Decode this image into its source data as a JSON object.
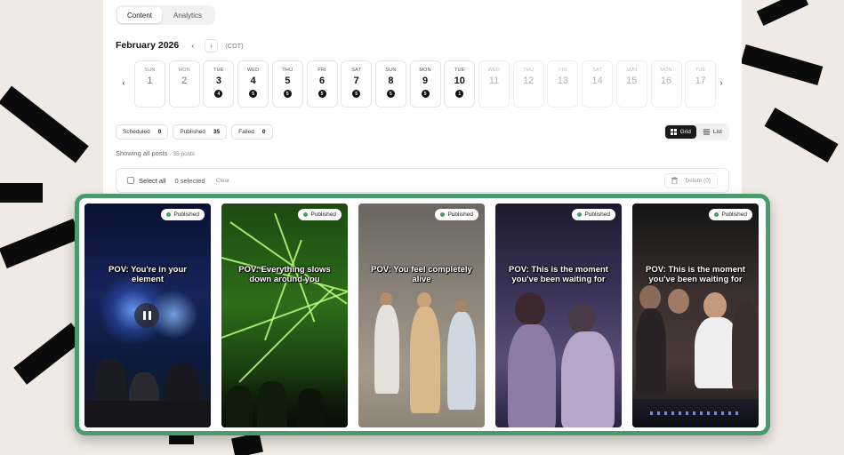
{
  "tabs": [
    {
      "label": "Content",
      "active": true
    },
    {
      "label": "Analytics",
      "active": false
    }
  ],
  "calendar": {
    "month": "February 2026",
    "prev_icon": "chevron-left-icon",
    "next_icon": "chevron-right-icon",
    "timezone": "(CDT)",
    "days": [
      {
        "dow": "SUN",
        "num": "1",
        "state": "normal"
      },
      {
        "dow": "MON",
        "num": "2",
        "state": "normal"
      },
      {
        "dow": "TUE",
        "num": "3",
        "state": "active",
        "count": "4"
      },
      {
        "dow": "WED",
        "num": "4",
        "state": "active",
        "count": "5"
      },
      {
        "dow": "THU",
        "num": "5",
        "state": "active",
        "count": "5"
      },
      {
        "dow": "FRI",
        "num": "6",
        "state": "active",
        "count": "5"
      },
      {
        "dow": "SAT",
        "num": "7",
        "state": "active",
        "count": "5"
      },
      {
        "dow": "SUN",
        "num": "8",
        "state": "active",
        "count": "5"
      },
      {
        "dow": "MON",
        "num": "9",
        "state": "active",
        "count": "5"
      },
      {
        "dow": "TUE",
        "num": "10",
        "state": "active",
        "count": "1"
      },
      {
        "dow": "WED",
        "num": "11",
        "state": "faded"
      },
      {
        "dow": "THU",
        "num": "12",
        "state": "faded"
      },
      {
        "dow": "FRI",
        "num": "13",
        "state": "faded"
      },
      {
        "dow": "SAT",
        "num": "14",
        "state": "faded"
      },
      {
        "dow": "SUN",
        "num": "15",
        "state": "faded"
      },
      {
        "dow": "MON",
        "num": "16",
        "state": "faded"
      },
      {
        "dow": "TUE",
        "num": "17",
        "state": "faded"
      }
    ]
  },
  "filters": [
    {
      "label": "Scheduled",
      "count": "0"
    },
    {
      "label": "Published",
      "count": "35"
    },
    {
      "label": "Failed",
      "count": "0"
    }
  ],
  "view": {
    "grid_label": "Grid",
    "list_label": "List",
    "grid_icon": "grid-icon",
    "list_icon": "list-icon",
    "active": "grid"
  },
  "showing": {
    "text": "Showing all posts",
    "sub": "· 35 posts"
  },
  "selection": {
    "select_all": "Select all",
    "selected": "0 selected",
    "clear": "Clear",
    "delete": "Delete (0)",
    "delete_icon": "trash-icon"
  },
  "posts": [
    {
      "status": "Published",
      "caption": "POV: You're in your element",
      "theme": "fireworks",
      "playing": true
    },
    {
      "status": "Published",
      "caption": "POV: Everything slows down around you",
      "theme": "lasers"
    },
    {
      "status": "Published",
      "caption": "POV: You feel completely alive",
      "theme": "crowd-day"
    },
    {
      "status": "Published",
      "caption": "POV: This is the moment you've been waiting for",
      "theme": "club-purple"
    },
    {
      "status": "Published",
      "caption": "POV: This is the moment you've been waiting for",
      "theme": "dj-booth"
    }
  ],
  "colors": {
    "frame": "#4a9a6c",
    "badge_dot": "#3aa565",
    "accent_dark": "#1a1a1a"
  }
}
